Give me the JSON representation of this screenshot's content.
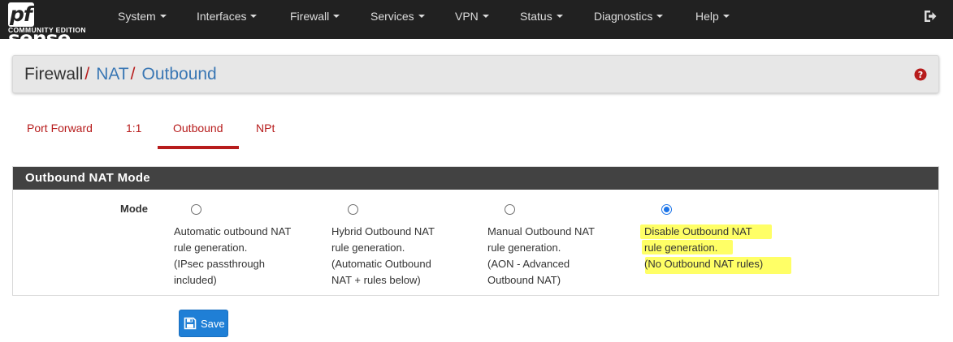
{
  "brand": {
    "name_pf": "pf",
    "name_sense": "sense",
    "edition": "COMMUNITY EDITION"
  },
  "nav": {
    "items": [
      {
        "label": "System"
      },
      {
        "label": "Interfaces"
      },
      {
        "label": "Firewall"
      },
      {
        "label": "Services"
      },
      {
        "label": "VPN"
      },
      {
        "label": "Status"
      },
      {
        "label": "Diagnostics"
      },
      {
        "label": "Help"
      }
    ],
    "logout_icon": "sign-out-icon"
  },
  "breadcrumb": {
    "items": [
      {
        "label": "Firewall",
        "separator": "/"
      },
      {
        "label": "NAT",
        "separator": "/"
      },
      {
        "label": "Outbound"
      }
    ],
    "help_icon": "question-circle-icon"
  },
  "tabs": [
    {
      "label": "Port Forward"
    },
    {
      "label": "1:1"
    },
    {
      "label": "Outbound",
      "active": true
    },
    {
      "label": "NPt"
    }
  ],
  "section": {
    "title": "Outbound NAT Mode",
    "mode_label": "Mode",
    "options": [
      {
        "lines": [
          "Automatic outbound NAT",
          "rule generation.",
          "(IPsec passthrough",
          "included)"
        ],
        "selected": false
      },
      {
        "lines": [
          "Hybrid Outbound NAT",
          "rule generation.",
          "(Automatic Outbound",
          "NAT + rules below)"
        ],
        "selected": false
      },
      {
        "lines": [
          "Manual Outbound NAT",
          "rule generation.",
          "(AON - Advanced",
          "Outbound NAT)"
        ],
        "selected": false
      },
      {
        "lines": [
          "Disable Outbound NAT",
          "rule generation.",
          "(No Outbound NAT rules)"
        ],
        "selected": true
      }
    ]
  },
  "save": {
    "label": "Save",
    "icon": "floppy-disk-icon"
  },
  "colors": {
    "navbar": "#212121",
    "accent": "#b71c1c",
    "link": "#3a77b4",
    "primary": "#1f7fd6",
    "highlight": "#ffff66"
  }
}
